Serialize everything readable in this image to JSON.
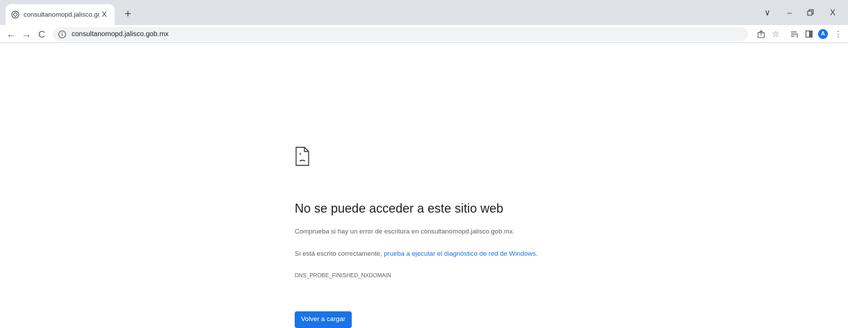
{
  "browser": {
    "tab": {
      "title": "consultanomopd.jalisco.gob.mx",
      "close": "X"
    },
    "new_tab": "+",
    "window_controls": {
      "tab_search": "∨",
      "minimize": "–",
      "restore": "▯",
      "close": "X"
    },
    "toolbar": {
      "back": "←",
      "forward": "→",
      "reload": "C",
      "url": "consultanomopd.jalisco.gob.mx",
      "site_info_icon": "info-icon",
      "actions": [
        "share-icon",
        "bookmark-star-icon",
        "reading-list-icon",
        "side-panel-icon"
      ],
      "profile_initial": "A",
      "menu": "⋮"
    }
  },
  "error_page": {
    "icon": "sad-page-icon",
    "headline": "No se puede acceder a este sitio web",
    "line1": "Comprueba si hay un error de escritura en consultanomopd.jalisco.gob.mx.",
    "line2_prefix": "Si está escrito correctamente, ",
    "line2_link": "prueba a ejecutar el diagnóstico de red de Windows",
    "line2_suffix": ".",
    "error_code": "DNS_PROBE_FINISHED_NXDOMAIN",
    "reload_button": "Volver a cargar"
  },
  "colors": {
    "accent": "#1a73e8",
    "tabstrip": "#dee1e6",
    "omnibox": "#f1f3f4",
    "body_text": "#5f6368"
  }
}
